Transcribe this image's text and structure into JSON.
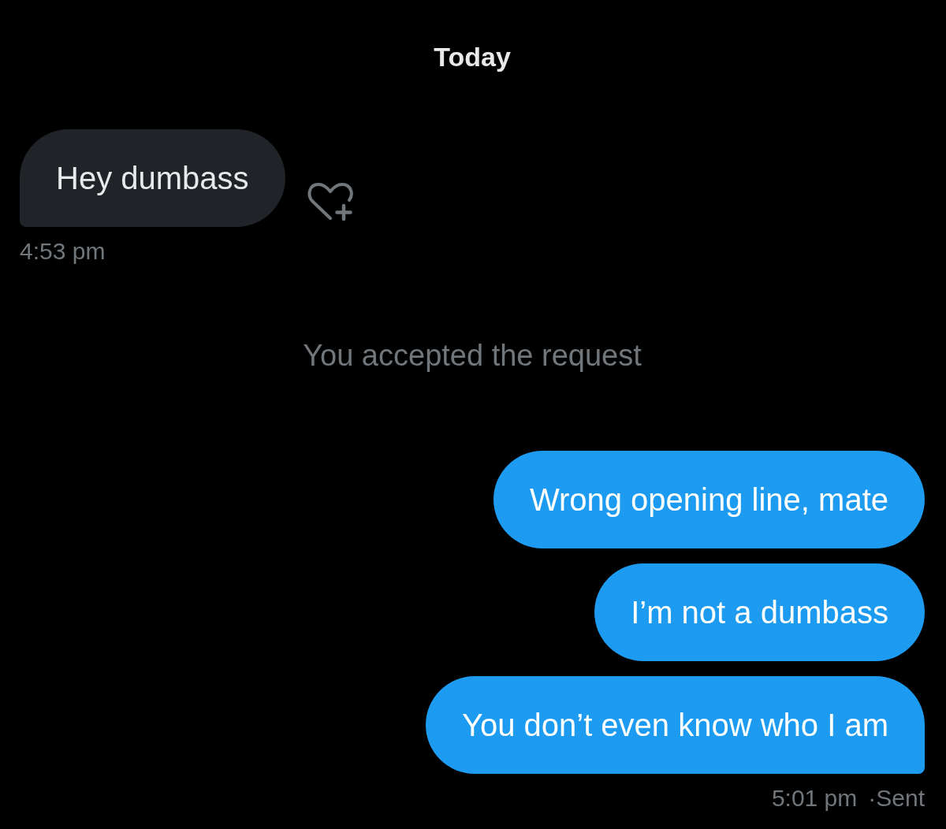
{
  "date_divider": "Today",
  "thread": [
    {
      "kind": "received",
      "messages": [
        "Hey dumbass"
      ],
      "time": "4:53 pm"
    },
    {
      "kind": "notice",
      "text": "You accepted the request"
    },
    {
      "kind": "sent",
      "messages": [
        "Wrong opening line, mate",
        "I’m not a dumbass",
        "You don’t even know who I am"
      ],
      "time": "5:01 pm",
      "status": "·Sent"
    }
  ]
}
